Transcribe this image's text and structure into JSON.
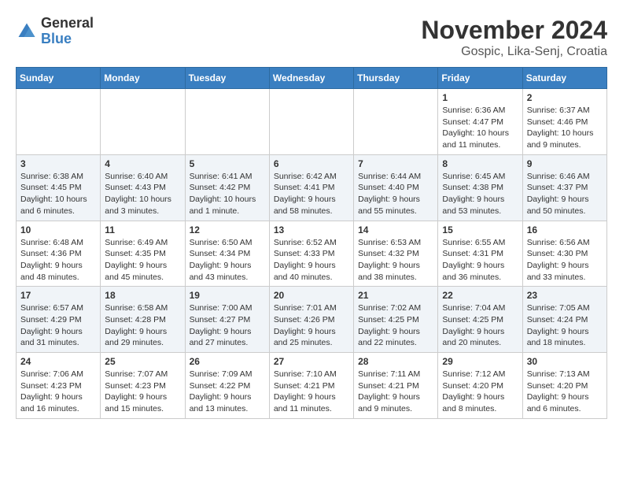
{
  "header": {
    "logo_general": "General",
    "logo_blue": "Blue",
    "month_title": "November 2024",
    "location": "Gospic, Lika-Senj, Croatia"
  },
  "days_of_week": [
    "Sunday",
    "Monday",
    "Tuesday",
    "Wednesday",
    "Thursday",
    "Friday",
    "Saturday"
  ],
  "weeks": [
    [
      {
        "day": "",
        "info": ""
      },
      {
        "day": "",
        "info": ""
      },
      {
        "day": "",
        "info": ""
      },
      {
        "day": "",
        "info": ""
      },
      {
        "day": "",
        "info": ""
      },
      {
        "day": "1",
        "info": "Sunrise: 6:36 AM\nSunset: 4:47 PM\nDaylight: 10 hours and 11 minutes."
      },
      {
        "day": "2",
        "info": "Sunrise: 6:37 AM\nSunset: 4:46 PM\nDaylight: 10 hours and 9 minutes."
      }
    ],
    [
      {
        "day": "3",
        "info": "Sunrise: 6:38 AM\nSunset: 4:45 PM\nDaylight: 10 hours and 6 minutes."
      },
      {
        "day": "4",
        "info": "Sunrise: 6:40 AM\nSunset: 4:43 PM\nDaylight: 10 hours and 3 minutes."
      },
      {
        "day": "5",
        "info": "Sunrise: 6:41 AM\nSunset: 4:42 PM\nDaylight: 10 hours and 1 minute."
      },
      {
        "day": "6",
        "info": "Sunrise: 6:42 AM\nSunset: 4:41 PM\nDaylight: 9 hours and 58 minutes."
      },
      {
        "day": "7",
        "info": "Sunrise: 6:44 AM\nSunset: 4:40 PM\nDaylight: 9 hours and 55 minutes."
      },
      {
        "day": "8",
        "info": "Sunrise: 6:45 AM\nSunset: 4:38 PM\nDaylight: 9 hours and 53 minutes."
      },
      {
        "day": "9",
        "info": "Sunrise: 6:46 AM\nSunset: 4:37 PM\nDaylight: 9 hours and 50 minutes."
      }
    ],
    [
      {
        "day": "10",
        "info": "Sunrise: 6:48 AM\nSunset: 4:36 PM\nDaylight: 9 hours and 48 minutes."
      },
      {
        "day": "11",
        "info": "Sunrise: 6:49 AM\nSunset: 4:35 PM\nDaylight: 9 hours and 45 minutes."
      },
      {
        "day": "12",
        "info": "Sunrise: 6:50 AM\nSunset: 4:34 PM\nDaylight: 9 hours and 43 minutes."
      },
      {
        "day": "13",
        "info": "Sunrise: 6:52 AM\nSunset: 4:33 PM\nDaylight: 9 hours and 40 minutes."
      },
      {
        "day": "14",
        "info": "Sunrise: 6:53 AM\nSunset: 4:32 PM\nDaylight: 9 hours and 38 minutes."
      },
      {
        "day": "15",
        "info": "Sunrise: 6:55 AM\nSunset: 4:31 PM\nDaylight: 9 hours and 36 minutes."
      },
      {
        "day": "16",
        "info": "Sunrise: 6:56 AM\nSunset: 4:30 PM\nDaylight: 9 hours and 33 minutes."
      }
    ],
    [
      {
        "day": "17",
        "info": "Sunrise: 6:57 AM\nSunset: 4:29 PM\nDaylight: 9 hours and 31 minutes."
      },
      {
        "day": "18",
        "info": "Sunrise: 6:58 AM\nSunset: 4:28 PM\nDaylight: 9 hours and 29 minutes."
      },
      {
        "day": "19",
        "info": "Sunrise: 7:00 AM\nSunset: 4:27 PM\nDaylight: 9 hours and 27 minutes."
      },
      {
        "day": "20",
        "info": "Sunrise: 7:01 AM\nSunset: 4:26 PM\nDaylight: 9 hours and 25 minutes."
      },
      {
        "day": "21",
        "info": "Sunrise: 7:02 AM\nSunset: 4:25 PM\nDaylight: 9 hours and 22 minutes."
      },
      {
        "day": "22",
        "info": "Sunrise: 7:04 AM\nSunset: 4:25 PM\nDaylight: 9 hours and 20 minutes."
      },
      {
        "day": "23",
        "info": "Sunrise: 7:05 AM\nSunset: 4:24 PM\nDaylight: 9 hours and 18 minutes."
      }
    ],
    [
      {
        "day": "24",
        "info": "Sunrise: 7:06 AM\nSunset: 4:23 PM\nDaylight: 9 hours and 16 minutes."
      },
      {
        "day": "25",
        "info": "Sunrise: 7:07 AM\nSunset: 4:23 PM\nDaylight: 9 hours and 15 minutes."
      },
      {
        "day": "26",
        "info": "Sunrise: 7:09 AM\nSunset: 4:22 PM\nDaylight: 9 hours and 13 minutes."
      },
      {
        "day": "27",
        "info": "Sunrise: 7:10 AM\nSunset: 4:21 PM\nDaylight: 9 hours and 11 minutes."
      },
      {
        "day": "28",
        "info": "Sunrise: 7:11 AM\nSunset: 4:21 PM\nDaylight: 9 hours and 9 minutes."
      },
      {
        "day": "29",
        "info": "Sunrise: 7:12 AM\nSunset: 4:20 PM\nDaylight: 9 hours and 8 minutes."
      },
      {
        "day": "30",
        "info": "Sunrise: 7:13 AM\nSunset: 4:20 PM\nDaylight: 9 hours and 6 minutes."
      }
    ]
  ]
}
